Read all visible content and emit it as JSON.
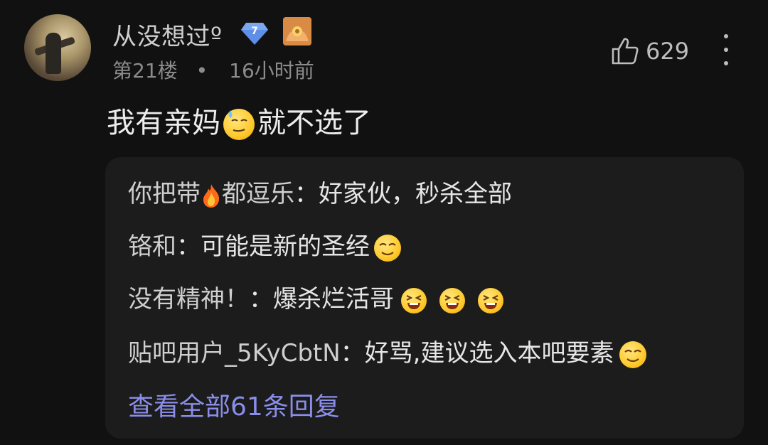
{
  "comment": {
    "username": "从没想过º",
    "level": "7",
    "floor": "第21楼",
    "separator": "•",
    "time": "16小时前",
    "like_count": "629",
    "text_before": "我有亲妈",
    "text_after": "就不选了",
    "emoji_in_text": "sweat-face-emoji"
  },
  "replies": [
    {
      "author": "你把带",
      "author_suffix": "都逗乐",
      "sep": "：",
      "text": "好家伙，秒杀全部",
      "author_emoji": "fire-emoji"
    },
    {
      "author": "铬和",
      "sep": "：",
      "text": "可能是新的圣经",
      "trailing_emoji": "smug-smile-emoji"
    },
    {
      "author": "没有精神！",
      "sep": "：",
      "text": "爆杀烂活哥",
      "trailing_emoji": "laugh-squint-emoji"
    },
    {
      "author": "贴吧用户_5KyCbtN",
      "sep": "：",
      "text": "好骂,建议选入本吧要素",
      "trailing_emoji": "smug-smile-emoji"
    }
  ],
  "view_all_label": "查看全部61条回复",
  "colors": {
    "background": "#111111",
    "reply_panel": "#1c1c1c",
    "link": "#8a8eea",
    "badge": "#5d8fe8"
  }
}
